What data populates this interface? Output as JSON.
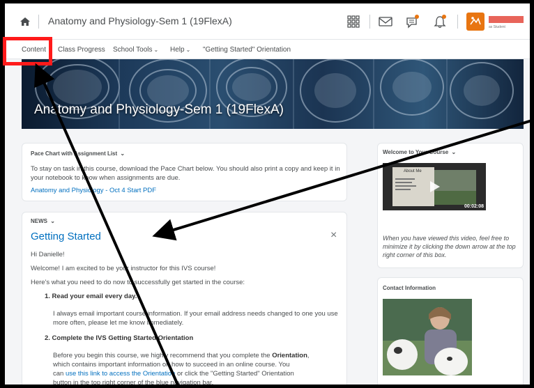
{
  "topbar": {
    "course_title": "Anatomy and Physiology-Sem 1 (19FlexA)",
    "user_role": "as Student",
    "icons": [
      "home-icon",
      "grid-icon",
      "mail-icon",
      "chat-icon",
      "bell-icon",
      "user-avatar"
    ],
    "accent_color": "#e87511",
    "notification_dot_color": "#e87511"
  },
  "nav": {
    "items": [
      {
        "label": "Content",
        "has_menu": false
      },
      {
        "label": "Class Progress",
        "has_menu": false
      },
      {
        "label": "School Tools",
        "has_menu": true
      },
      {
        "label": "Help",
        "has_menu": true
      },
      {
        "label": "\"Getting Started\" Orientation",
        "has_menu": false
      }
    ]
  },
  "banner": {
    "title": "Anatomy and Physiology-Sem 1 (19FlexA)"
  },
  "pace_card": {
    "heading": "Pace Chart with Assignment List",
    "body": "To stay on task in this course, download the Pace Chart below.  You should also print a copy and keep it in your notebook to know when assignments are due.",
    "link": "Anatomy and Physiology - Oct 4 Start PDF"
  },
  "news_card": {
    "heading": "NEWS",
    "title": "Getting Started",
    "close": "×",
    "greeting": "Hi Danielle!",
    "welcome": "Welcome! I am excited to be your instructor for this IVS course!",
    "intro": "Here's what you need to do now to successfully get started in the course:",
    "step1_title": "1. Read your email every day.",
    "step1_body": "I always email important course information.  If your email address needs changed to one you use more often, please let me know immediately.",
    "step2_title": "2. Complete the IVS Getting Started Orientation",
    "step2_line1_a": "Before you begin this course, we highly recommend that you complete the ",
    "step2_line1_b": "Orientation",
    "step2_line1_c": ",",
    "step2_line2": "which contains important information on how to succeed in an online course.  You",
    "step2_line3_a": "can ",
    "step2_line3_link": "use this link to access the Orientation",
    "step2_line3_b": " or click the \"Getting Started\" Orientation",
    "step2_line4": "button in the top right corner of the blue navigation bar."
  },
  "video_card": {
    "heading": "Welcome to Your Course",
    "duration": "00:02:08",
    "thumb_title": "About Me",
    "caption": "When you have viewed this video, feel free to minimize it by clicking the down arrow at the top right corner of this box."
  },
  "contact_card": {
    "heading": "Contact Information"
  },
  "annotation": {
    "box_color": "#ff1a1a",
    "arrow_color": "#000000"
  }
}
